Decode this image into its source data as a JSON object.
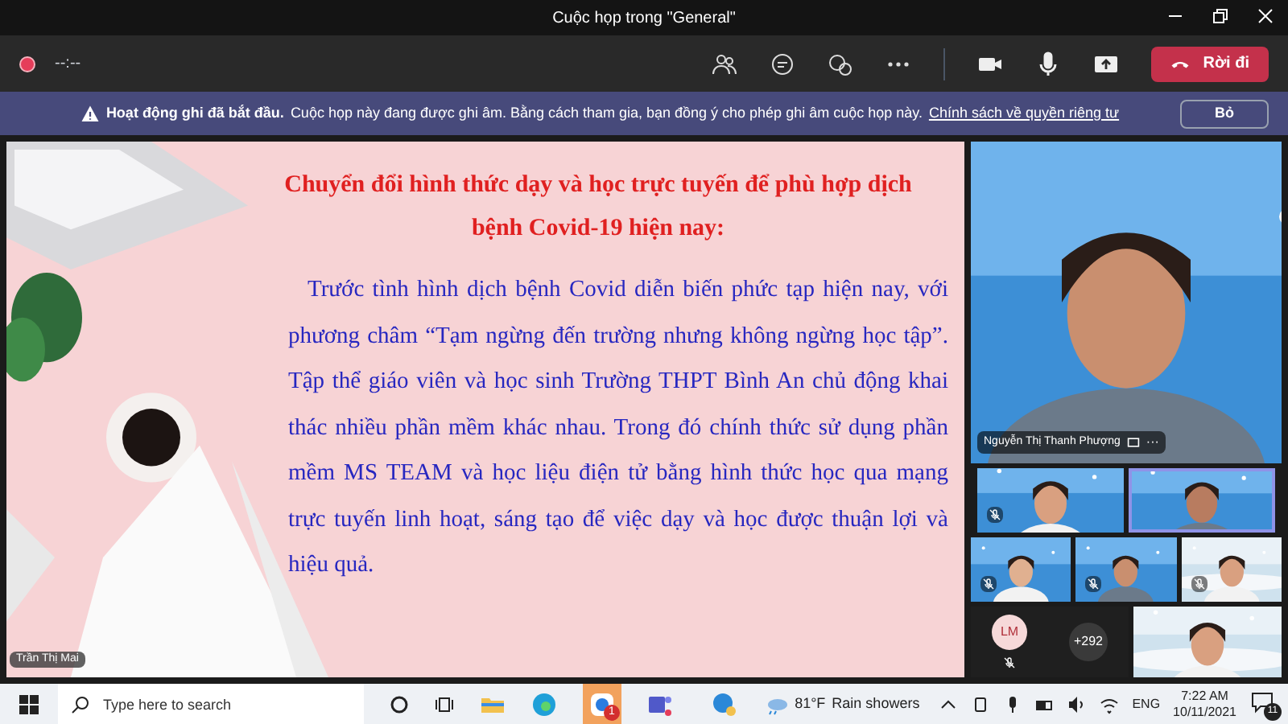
{
  "window": {
    "title": "Cuộc họp trong \"General\""
  },
  "toolbar": {
    "recording": true,
    "timer": "--:--",
    "leave": "Rời đi"
  },
  "banner": {
    "heading": "Hoạt động ghi đã bắt đầu.",
    "text": "Cuộc họp này đang được ghi âm. Bằng cách tham gia, bạn đồng ý cho phép ghi âm cuộc họp này.",
    "link": "Chính sách về quyền riêng tư",
    "dismiss": "Bỏ"
  },
  "share": {
    "title_lines": [
      "Chuyển đổi hình thức dạy và học trực tuyến để phù hợp dịch",
      "bệnh Covid-19 hiện nay:"
    ],
    "body": "Trước tình hình dịch bệnh Covid diễn biến phức tạp hiện nay, với phương châm “Tạm ngừng đến trường nhưng không ngừng học tập”. Tập thể giáo viên và học sinh Trường THPT Bình An chủ động khai thác nhiều phần mềm khác nhau. Trong đó chính thức sử dụng phần mềm MS TEAM và học liệu điện tử bằng hình thức học qua mạng trực tuyến linh hoạt, sáng tạo để việc dạy và học được thuận lợi và hiệu quả.",
    "presenter": "Trần Thị Mai"
  },
  "featured": {
    "name": "Nguyễn Thị Thanh Phượng",
    "more": "···"
  },
  "tiles": [
    {
      "muted": true,
      "speaking": false
    },
    {
      "muted": false,
      "speaking": true
    },
    {
      "muted": true,
      "speaking": false
    },
    {
      "muted": true,
      "speaking": false
    },
    {
      "muted": true,
      "speaking": false
    }
  ],
  "avatar": {
    "initials": "LM",
    "muted": true
  },
  "overflow": "+292",
  "taskbar": {
    "search_placeholder": "Type here to search",
    "app_badge": "1",
    "temperature": "81°F",
    "weather": "Rain showers",
    "language": "ENG",
    "time": "7:22 AM",
    "date": "10/11/2021",
    "notifications": "11"
  }
}
